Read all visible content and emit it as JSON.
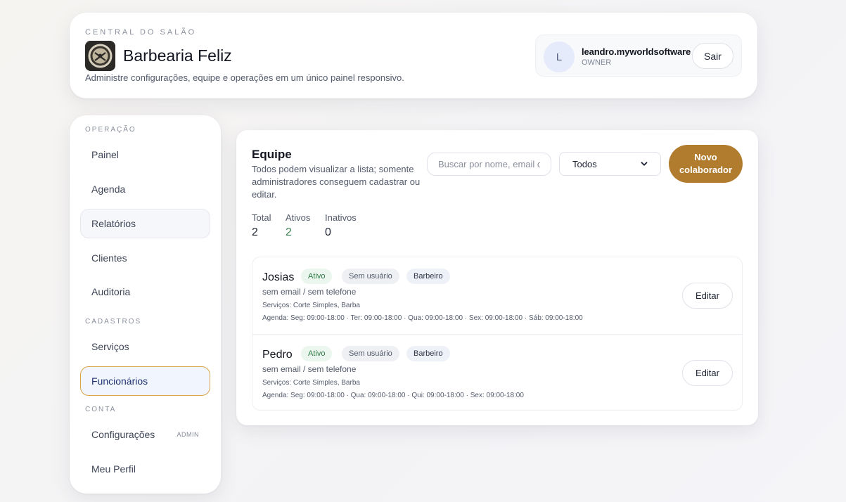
{
  "header": {
    "eyebrow": "CENTRAL DO SALÃO",
    "salon_name": "Barbearia Feliz",
    "description": "Administre configurações, equipe e operações em um único painel responsivo.",
    "user": {
      "avatar_initial": "L",
      "name": "leandro.myworldsoftware",
      "role": "OWNER",
      "logout_label": "Sair"
    }
  },
  "sidebar": {
    "sections": [
      {
        "title": "OPERAÇÃO",
        "items": [
          "Painel",
          "Agenda",
          "Relatórios",
          "Clientes",
          "Auditoria"
        ]
      },
      {
        "title": "CADASTROS",
        "items": [
          "Serviços",
          "Funcionários"
        ]
      },
      {
        "title": "CONTA",
        "items": [
          "Configurações",
          "Meu Perfil"
        ]
      }
    ],
    "admin_badge": "ADMIN",
    "active_item": "Funcionários",
    "hovered_item": "Relatórios"
  },
  "main": {
    "title": "Equipe",
    "description": "Todos podem visualizar a lista; somente administradores conseguem cadastrar ou editar.",
    "search_placeholder": "Buscar por nome, email ou",
    "filter_value": "Todos",
    "new_button": "Novo colaborador",
    "stats": {
      "total_label": "Total",
      "total_value": "2",
      "active_label": "Ativos",
      "active_value": "2",
      "inactive_label": "Inativos",
      "inactive_value": "0"
    },
    "employees": [
      {
        "name": "Josias",
        "status": "Ativo",
        "user_tag": "Sem usuário",
        "role": "Barbeiro",
        "contact": "sem email / sem telefone",
        "services": "Serviços: Corte Simples, Barba",
        "schedule": "Agenda: Seg: 09:00-18:00 · Ter: 09:00-18:00 · Qua: 09:00-18:00 · Sex: 09:00-18:00 · Sáb: 09:00-18:00",
        "edit_label": "Editar"
      },
      {
        "name": "Pedro",
        "status": "Ativo",
        "user_tag": "Sem usuário",
        "role": "Barbeiro",
        "contact": "sem email / sem telefone",
        "services": "Serviços: Corte Simples, Barba",
        "schedule": "Agenda: Seg: 09:00-18:00 · Qua: 09:00-18:00 · Qui: 09:00-18:00 · Sex: 09:00-18:00",
        "edit_label": "Editar"
      }
    ]
  },
  "colors": {
    "accent": "#b17c2e",
    "active_border": "#d9a347",
    "status_green": "#2f7a45"
  }
}
